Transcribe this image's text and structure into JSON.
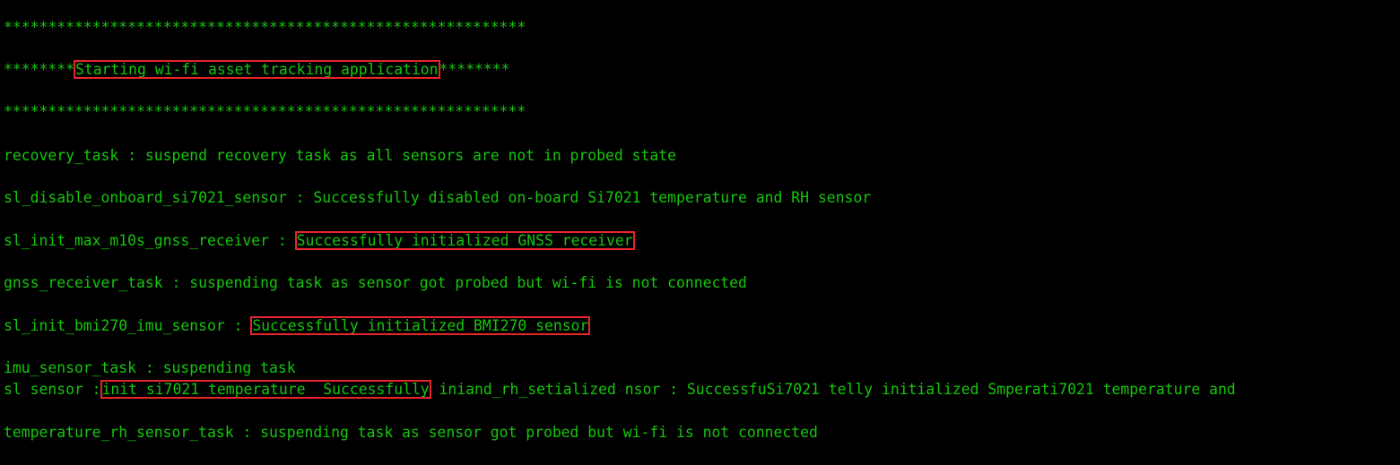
{
  "terminal": {
    "colors": {
      "background": "#000000",
      "text": "#16c60c",
      "highlight_box": "#e8242a"
    },
    "lines": {
      "stars_top": "***********************************************************",
      "banner_prefix": "********",
      "banner_text": "Starting wi-fi asset tracking application",
      "banner_suffix": "********",
      "stars_bottom": "***********************************************************",
      "recovery": "recovery_task : suspend recovery task as all sensors are not in probed state",
      "si7021_disable": "sl_disable_onboard_si7021_sensor : Successfully disabled on-board Si7021 temperature and RH sensor",
      "gnss_init_prefix": "sl_init_max_m10s_gnss_receiver : ",
      "gnss_init_result": "Successfully initialized GNSS receiver",
      "gnss_task": "gnss_receiver_task : suspending task as sensor got probed but wi-fi is not connected",
      "bmi_init_prefix": "sl_init_bmi270_imu_sensor : ",
      "bmi_init_result": "Successfully initialized BMI270 sensor",
      "imu_task": "imu_sensor_task : suspending task",
      "garbled_prefix": "sl sensor :",
      "garbled_highlight": "init_si7021_temperature_ Successfully",
      "garbled_rest": " iniand_rh_setialized nsor : SuccessfuSi7021 telly initialized Smperati7021 temperature and",
      "temp_task": "temperature_rh_sensor_task : suspending task as sensor got probed but wi-fi is not connected"
    }
  }
}
